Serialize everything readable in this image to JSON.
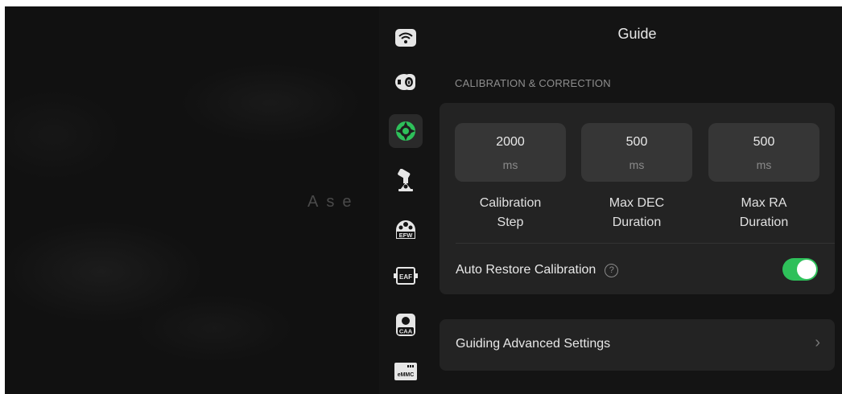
{
  "background": {
    "watermark": "Ase"
  },
  "sidebar": {
    "items": [
      {
        "name": "wifi-icon",
        "active": false
      },
      {
        "name": "camera-icon",
        "active": false
      },
      {
        "name": "guide-icon",
        "active": true
      },
      {
        "name": "telescope-mount-icon",
        "active": false
      },
      {
        "name": "efw-icon",
        "label": "EFW",
        "active": false
      },
      {
        "name": "eaf-icon",
        "label": "EAF",
        "active": false
      },
      {
        "name": "caa-icon",
        "label": "CAA",
        "active": false
      },
      {
        "name": "emmc-icon",
        "label": "eMMC",
        "active": false
      }
    ]
  },
  "panel": {
    "title": "Guide",
    "section_title": "CALIBRATION & CORRECTION",
    "fields": [
      {
        "value": "2000",
        "unit": "ms",
        "label_line1": "Calibration",
        "label_line2": "Step"
      },
      {
        "value": "500",
        "unit": "ms",
        "label_line1": "Max DEC",
        "label_line2": "Duration"
      },
      {
        "value": "500",
        "unit": "ms",
        "label_line1": "Max RA",
        "label_line2": "Duration"
      }
    ],
    "auto_restore": {
      "label": "Auto Restore Calibration",
      "help_symbol": "?",
      "enabled": true
    },
    "advanced": {
      "label": "Guiding Advanced Settings",
      "chevron": "›"
    }
  },
  "colors": {
    "accent_green": "#2ec05a",
    "background": "#141414",
    "card": "#232323"
  }
}
